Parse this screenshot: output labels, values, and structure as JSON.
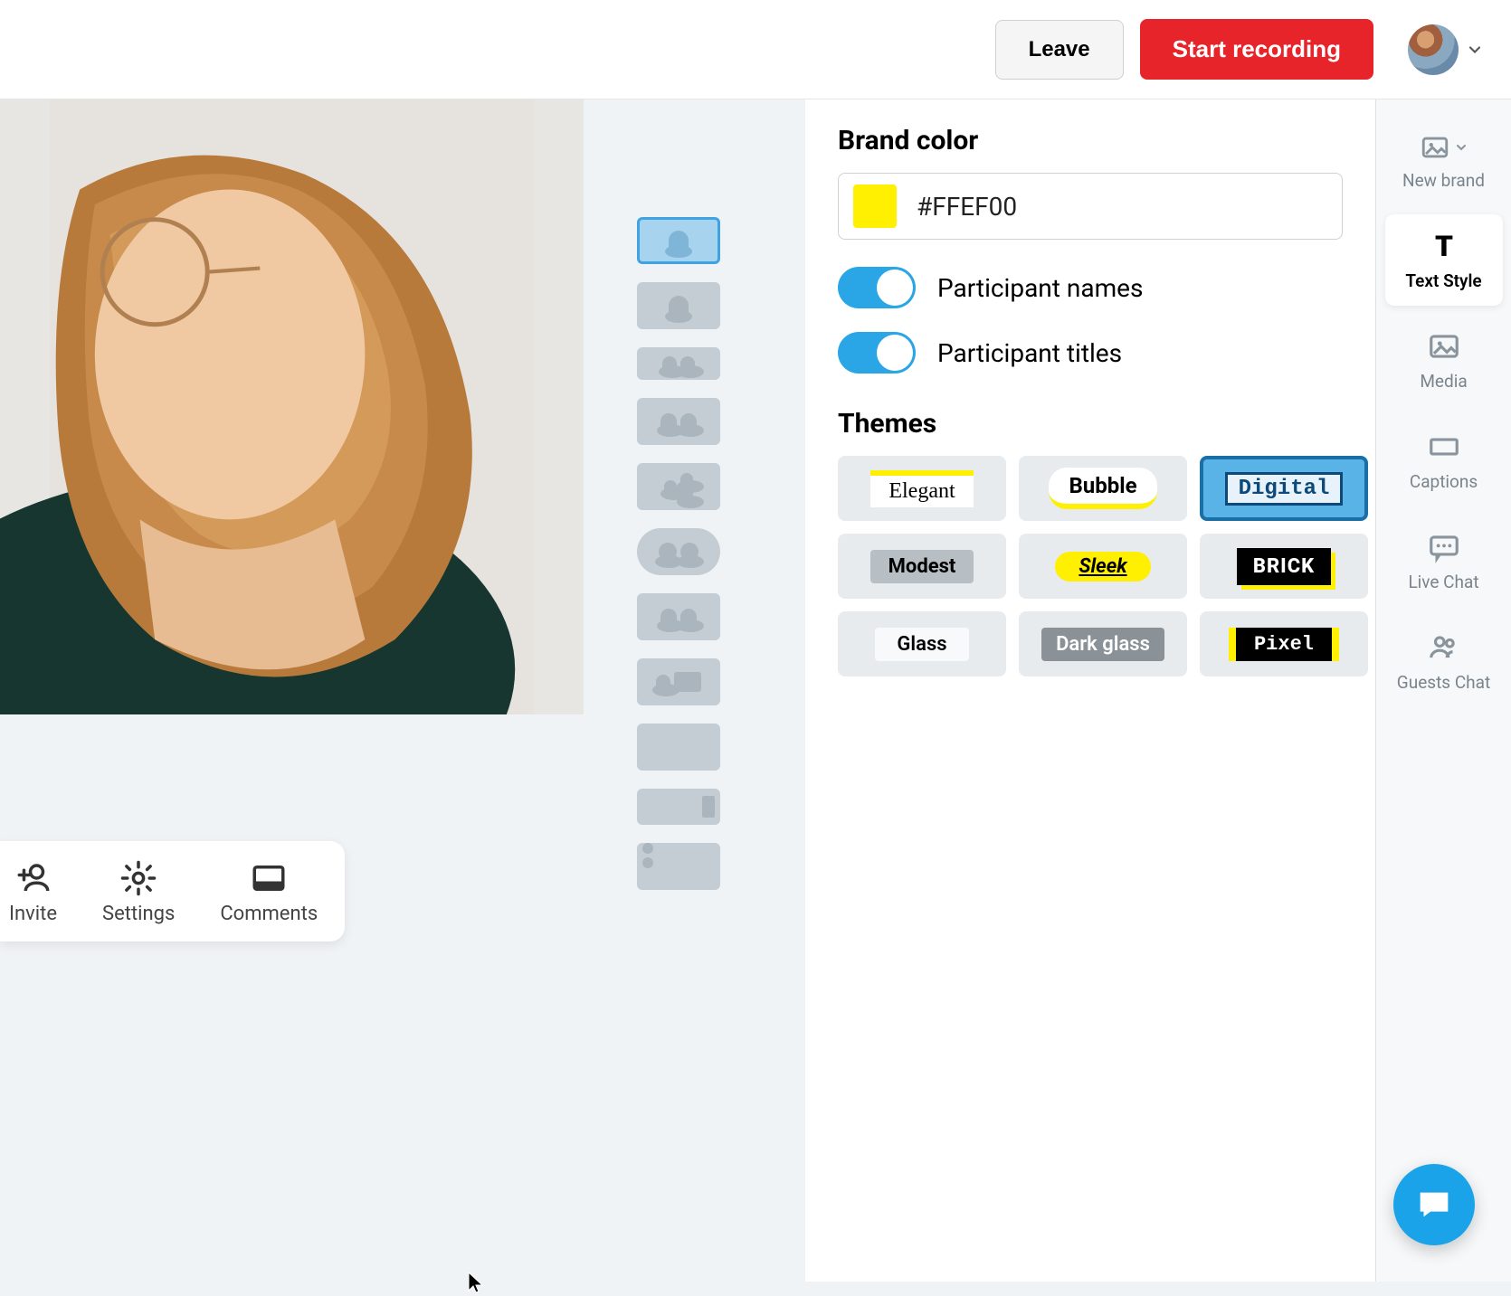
{
  "header": {
    "leave_label": "Leave",
    "record_label": "Start recording"
  },
  "controls": {
    "invite_label": "Invite",
    "settings_label": "Settings",
    "comments_label": "Comments"
  },
  "panel": {
    "brand_heading": "Brand color",
    "brand_value": "#FFEF00",
    "toggle_names_label": "Participant names",
    "toggle_titles_label": "Participant titles",
    "themes_heading": "Themes",
    "themes": {
      "elegant": "Elegant",
      "bubble": "Bubble",
      "digital": "Digital",
      "modest": "Modest",
      "sleek": "Sleek",
      "brick": "BRICK",
      "glass": "Glass",
      "darkglass": "Dark glass",
      "pixel": "Pixel"
    }
  },
  "rail": {
    "new_brand": "New brand",
    "text_style": "Text Style",
    "media": "Media",
    "captions": "Captions",
    "live_chat": "Live Chat",
    "guests_chat": "Guests Chat"
  },
  "colors": {
    "brand": "#FFEF00",
    "accent": "#2aa6e6",
    "danger": "#e62429"
  }
}
